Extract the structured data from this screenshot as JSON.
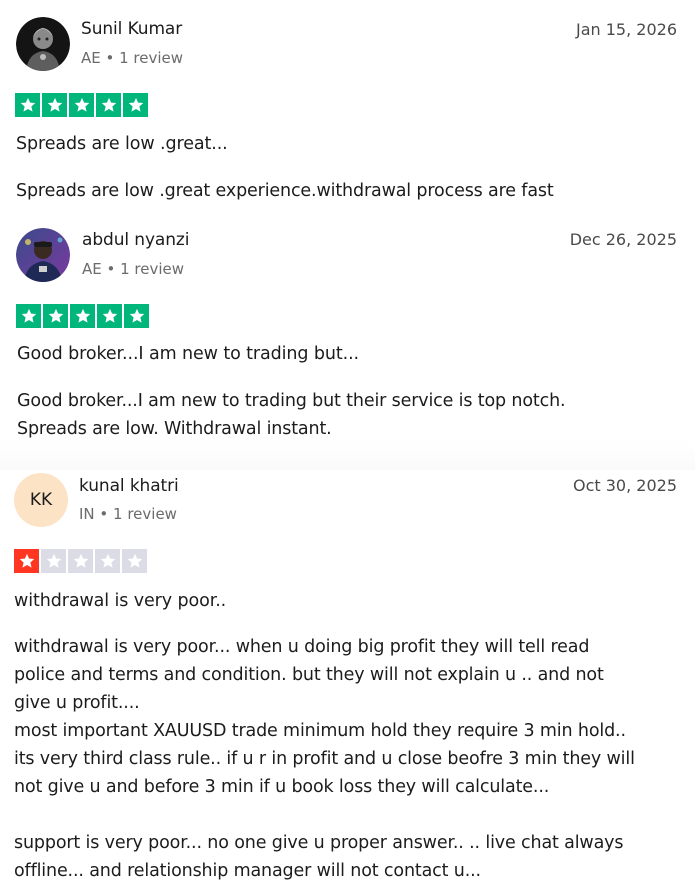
{
  "reviews": [
    {
      "name": "Sunil Kumar",
      "meta": "AE • 1 review",
      "date": "Jan 15, 2026",
      "rating": 5,
      "title": "Spreads are low .great...",
      "body": "Spreads are low .great experience.withdrawal process are fast",
      "avatar_icon": "profile-photo-icon"
    },
    {
      "name": "abdul nyanzi",
      "meta": "AE • 1 review",
      "date": "Dec 26, 2025",
      "rating": 5,
      "title": "Good broker...I am new to trading but...",
      "body": "Good broker...I am new to trading but their service is top notch.\nSpreads are low. Withdrawal instant.",
      "avatar_icon": "profile-photo-icon"
    },
    {
      "name": "kunal khatri",
      "meta": "IN • 1 review",
      "date": "Oct 30, 2025",
      "rating": 1,
      "initials": "KK",
      "title": "withdrawal is very poor..",
      "body": "withdrawal is very poor... when u doing big profit they will tell read\npolice and terms and condition. but they will not explain u .. and not\ngive u profit....\nmost important XAUUSD trade minimum hold they require 3 min hold..\nits very third class rule.. if u r in profit and u close beofre 3 min they will\nnot give u and before 3 min if u book loss they will calculate...\n\nsupport is very poor... no one give u proper answer.. .. live chat always\noffline... and relationship manager will not contact u..."
    }
  ],
  "colors": {
    "star_green": "#00b67a",
    "star_red": "#ff3722",
    "star_empty": "#dcdce6",
    "initials_bg": "#fde3c6"
  }
}
